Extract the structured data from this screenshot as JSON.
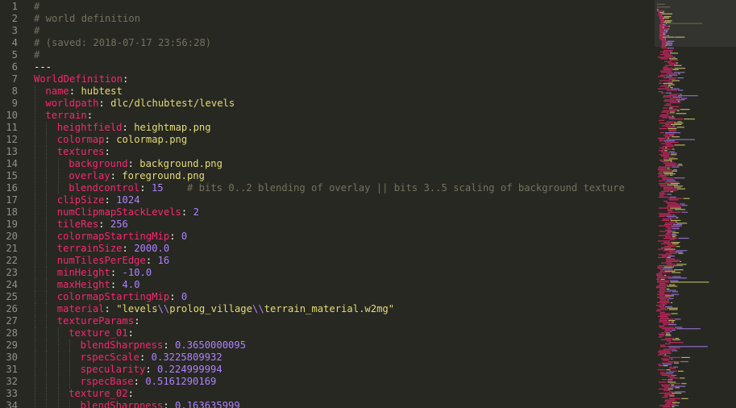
{
  "editor": {
    "line_numbers": [
      "1",
      "2",
      "3",
      "4",
      "5",
      "6",
      "7",
      "8",
      "9",
      "10",
      "11",
      "12",
      "13",
      "14",
      "15",
      "16",
      "17",
      "18",
      "19",
      "20",
      "21",
      "22",
      "23",
      "24",
      "25",
      "26",
      "27",
      "28",
      "29",
      "30",
      "31",
      "32",
      "33",
      "34"
    ],
    "lines": [
      {
        "indent": 0,
        "tokens": [
          {
            "t": "#",
            "c": "c"
          }
        ]
      },
      {
        "indent": 0,
        "tokens": [
          {
            "t": "# world definition",
            "c": "c"
          }
        ]
      },
      {
        "indent": 0,
        "tokens": [
          {
            "t": "#",
            "c": "c"
          }
        ]
      },
      {
        "indent": 0,
        "tokens": [
          {
            "t": "# (saved: 2018-07-17 23:56:28)",
            "c": "c"
          }
        ]
      },
      {
        "indent": 0,
        "tokens": [
          {
            "t": "#",
            "c": "c"
          }
        ]
      },
      {
        "indent": 0,
        "tokens": [
          {
            "t": "---",
            "c": "p"
          }
        ]
      },
      {
        "indent": 0,
        "tokens": [
          {
            "t": "WorldDefinition",
            "c": "k"
          },
          {
            "t": ":",
            "c": "p"
          }
        ]
      },
      {
        "indent": 1,
        "tokens": [
          {
            "t": "name",
            "c": "k"
          },
          {
            "t": ": ",
            "c": "p"
          },
          {
            "t": "hubtest",
            "c": "s"
          }
        ]
      },
      {
        "indent": 1,
        "tokens": [
          {
            "t": "worldpath",
            "c": "k"
          },
          {
            "t": ": ",
            "c": "p"
          },
          {
            "t": "dlc/dlchubtest/levels",
            "c": "s"
          }
        ]
      },
      {
        "indent": 1,
        "tokens": [
          {
            "t": "terrain",
            "c": "k"
          },
          {
            "t": ":",
            "c": "p"
          }
        ]
      },
      {
        "indent": 2,
        "tokens": [
          {
            "t": "heightfield",
            "c": "k"
          },
          {
            "t": ": ",
            "c": "p"
          },
          {
            "t": "heightmap.png",
            "c": "s"
          }
        ]
      },
      {
        "indent": 2,
        "tokens": [
          {
            "t": "colormap",
            "c": "k"
          },
          {
            "t": ": ",
            "c": "p"
          },
          {
            "t": "colormap.png",
            "c": "s"
          }
        ]
      },
      {
        "indent": 2,
        "tokens": [
          {
            "t": "textures",
            "c": "k"
          },
          {
            "t": ":",
            "c": "p"
          }
        ]
      },
      {
        "indent": 3,
        "tokens": [
          {
            "t": "background",
            "c": "k"
          },
          {
            "t": ": ",
            "c": "p"
          },
          {
            "t": "background.png",
            "c": "s"
          }
        ]
      },
      {
        "indent": 3,
        "tokens": [
          {
            "t": "overlay",
            "c": "k"
          },
          {
            "t": ": ",
            "c": "p"
          },
          {
            "t": "foreground.png",
            "c": "s"
          }
        ]
      },
      {
        "indent": 3,
        "tokens": [
          {
            "t": "blendcontrol",
            "c": "k"
          },
          {
            "t": ": ",
            "c": "p"
          },
          {
            "t": "15",
            "c": "n"
          },
          {
            "t": "    # bits 0..2 blending of overlay || bits 3..5 scaling of background texture",
            "c": "c"
          }
        ]
      },
      {
        "indent": 2,
        "tokens": [
          {
            "t": "clipSize",
            "c": "k"
          },
          {
            "t": ": ",
            "c": "p"
          },
          {
            "t": "1024",
            "c": "n"
          }
        ]
      },
      {
        "indent": 2,
        "tokens": [
          {
            "t": "numClipmapStackLevels",
            "c": "k"
          },
          {
            "t": ": ",
            "c": "p"
          },
          {
            "t": "2",
            "c": "n"
          }
        ]
      },
      {
        "indent": 2,
        "tokens": [
          {
            "t": "tileRes",
            "c": "k"
          },
          {
            "t": ": ",
            "c": "p"
          },
          {
            "t": "256",
            "c": "n"
          }
        ]
      },
      {
        "indent": 2,
        "tokens": [
          {
            "t": "colormapStartingMip",
            "c": "k"
          },
          {
            "t": ": ",
            "c": "p"
          },
          {
            "t": "0",
            "c": "n"
          }
        ]
      },
      {
        "indent": 2,
        "tokens": [
          {
            "t": "terrainSize",
            "c": "k"
          },
          {
            "t": ": ",
            "c": "p"
          },
          {
            "t": "2000.0",
            "c": "n"
          }
        ]
      },
      {
        "indent": 2,
        "tokens": [
          {
            "t": "numTilesPerEdge",
            "c": "k"
          },
          {
            "t": ": ",
            "c": "p"
          },
          {
            "t": "16",
            "c": "n"
          }
        ]
      },
      {
        "indent": 2,
        "tokens": [
          {
            "t": "minHeight",
            "c": "k"
          },
          {
            "t": ": ",
            "c": "p"
          },
          {
            "t": "-10.0",
            "c": "n"
          }
        ]
      },
      {
        "indent": 2,
        "tokens": [
          {
            "t": "maxHeight",
            "c": "k"
          },
          {
            "t": ": ",
            "c": "p"
          },
          {
            "t": "4.0",
            "c": "n"
          }
        ]
      },
      {
        "indent": 2,
        "tokens": [
          {
            "t": "colormapStartingMip",
            "c": "k"
          },
          {
            "t": ": ",
            "c": "p"
          },
          {
            "t": "0",
            "c": "n"
          }
        ]
      },
      {
        "indent": 2,
        "tokens": [
          {
            "t": "material",
            "c": "k"
          },
          {
            "t": ": ",
            "c": "p"
          },
          {
            "t": "\"levels",
            "c": "s"
          },
          {
            "t": "\\\\",
            "c": "n"
          },
          {
            "t": "prolog_village",
            "c": "s"
          },
          {
            "t": "\\\\",
            "c": "n"
          },
          {
            "t": "terrain_material.w2mg\"",
            "c": "s"
          }
        ]
      },
      {
        "indent": 2,
        "tokens": [
          {
            "t": "textureParams",
            "c": "k"
          },
          {
            "t": ":",
            "c": "p"
          }
        ]
      },
      {
        "indent": 3,
        "tokens": [
          {
            "t": "texture_01",
            "c": "k"
          },
          {
            "t": ":",
            "c": "p"
          }
        ]
      },
      {
        "indent": 4,
        "tokens": [
          {
            "t": "blendSharpness",
            "c": "k"
          },
          {
            "t": ": ",
            "c": "p"
          },
          {
            "t": "0.3650000095",
            "c": "n"
          }
        ]
      },
      {
        "indent": 4,
        "tokens": [
          {
            "t": "rspecScale",
            "c": "k"
          },
          {
            "t": ": ",
            "c": "p"
          },
          {
            "t": "0.3225809932",
            "c": "n"
          }
        ]
      },
      {
        "indent": 4,
        "tokens": [
          {
            "t": "specularity",
            "c": "k"
          },
          {
            "t": ": ",
            "c": "p"
          },
          {
            "t": "0.224999994",
            "c": "n"
          }
        ]
      },
      {
        "indent": 4,
        "tokens": [
          {
            "t": "rspecBase",
            "c": "k"
          },
          {
            "t": ": ",
            "c": "p"
          },
          {
            "t": "0.5161290169",
            "c": "n"
          }
        ]
      },
      {
        "indent": 3,
        "tokens": [
          {
            "t": "texture_02",
            "c": "k"
          },
          {
            "t": ":",
            "c": "p"
          }
        ]
      },
      {
        "indent": 4,
        "tokens": [
          {
            "t": "blendSharpness",
            "c": "k"
          },
          {
            "t": ": ",
            "c": "p"
          },
          {
            "t": "0.163635999",
            "c": "n"
          }
        ]
      }
    ]
  },
  "theme": {
    "background": "#272822",
    "comment": "#75715e",
    "key": "#f92672",
    "string": "#e6db74",
    "number": "#ae81ff",
    "line_number": "#8f908a"
  }
}
